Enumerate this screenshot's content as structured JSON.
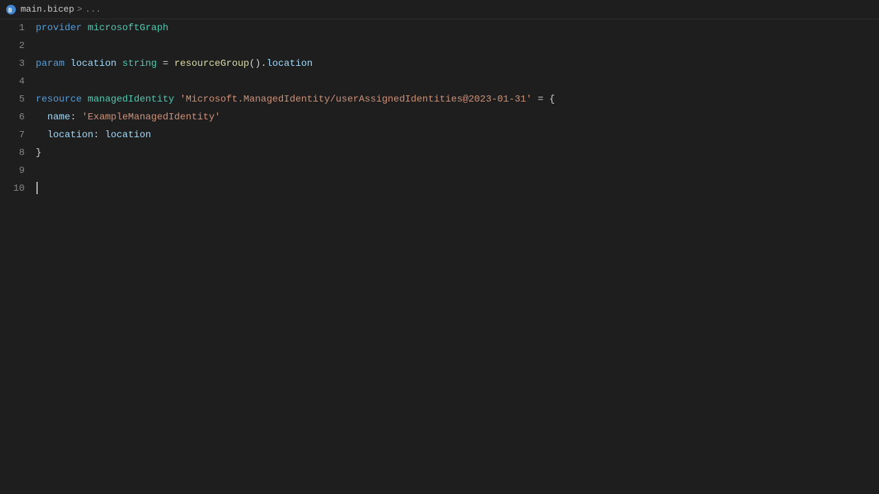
{
  "titlebar": {
    "icon": "bicep-icon",
    "filename": "main.bicep",
    "separator": ">",
    "breadcrumb": "..."
  },
  "editor": {
    "lines": [
      {
        "number": "1",
        "tokens": [
          {
            "type": "keyword-provider",
            "text": "provider"
          },
          {
            "type": "space",
            "text": " "
          },
          {
            "type": "ident-provider",
            "text": "microsoftGraph"
          }
        ]
      },
      {
        "number": "2",
        "tokens": []
      },
      {
        "number": "3",
        "tokens": [
          {
            "type": "keyword-param",
            "text": "param"
          },
          {
            "type": "space",
            "text": " "
          },
          {
            "type": "ident",
            "text": "location"
          },
          {
            "type": "space",
            "text": " "
          },
          {
            "type": "type",
            "text": "string"
          },
          {
            "type": "space",
            "text": " "
          },
          {
            "type": "punct",
            "text": "="
          },
          {
            "type": "space",
            "text": " "
          },
          {
            "type": "func",
            "text": "resourceGroup"
          },
          {
            "type": "punct",
            "text": "()"
          },
          {
            "type": "punct",
            "text": "."
          },
          {
            "type": "prop",
            "text": "location"
          }
        ]
      },
      {
        "number": "4",
        "tokens": []
      },
      {
        "number": "5",
        "tokens": [
          {
            "type": "keyword-resource",
            "text": "resource"
          },
          {
            "type": "space",
            "text": " "
          },
          {
            "type": "ident-resource",
            "text": "managedIdentity"
          },
          {
            "type": "space",
            "text": " "
          },
          {
            "type": "str-literal",
            "text": "'Microsoft.ManagedIdentity/userAssignedIdentities@2023-01-31'"
          },
          {
            "type": "space",
            "text": " "
          },
          {
            "type": "punct",
            "text": "= {"
          }
        ]
      },
      {
        "number": "6",
        "tokens": [
          {
            "type": "indent",
            "text": "  "
          },
          {
            "type": "prop-key",
            "text": "name"
          },
          {
            "type": "punct",
            "text": ":"
          },
          {
            "type": "space",
            "text": " "
          },
          {
            "type": "str-literal",
            "text": "'ExampleManagedIdentity'"
          }
        ]
      },
      {
        "number": "7",
        "tokens": [
          {
            "type": "indent",
            "text": "  "
          },
          {
            "type": "prop-key",
            "text": "location"
          },
          {
            "type": "punct",
            "text": ":"
          },
          {
            "type": "space",
            "text": " "
          },
          {
            "type": "ident-value",
            "text": "location"
          }
        ]
      },
      {
        "number": "8",
        "tokens": [
          {
            "type": "punct",
            "text": "}"
          }
        ]
      },
      {
        "number": "9",
        "tokens": []
      },
      {
        "number": "10",
        "tokens": [],
        "cursor": true
      }
    ]
  }
}
